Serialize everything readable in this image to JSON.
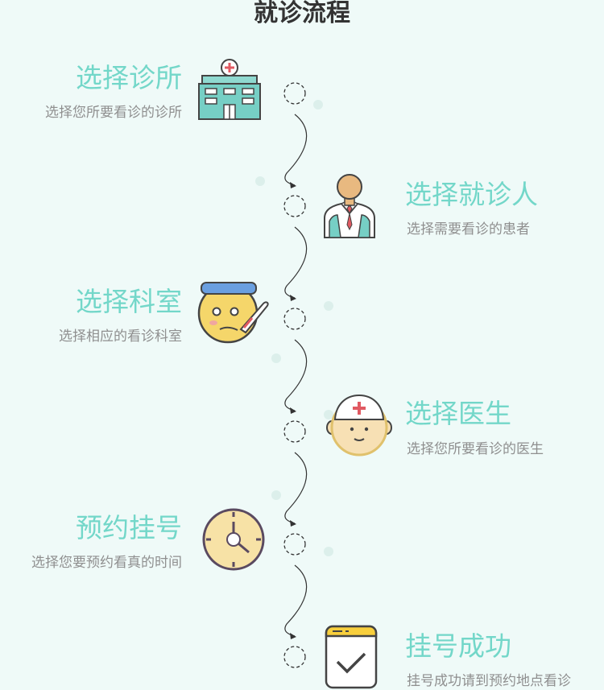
{
  "title": "就诊流程",
  "steps": [
    {
      "title": "选择诊所",
      "desc": "选择您所要看诊的诊所",
      "icon": "hospital-building-icon"
    },
    {
      "title": "选择就诊人",
      "desc": "选择需要看诊的患者",
      "icon": "doctor-person-icon"
    },
    {
      "title": "选择科室",
      "desc": "选择相应的看诊科室",
      "icon": "sick-face-thermometer-icon"
    },
    {
      "title": "选择医生",
      "desc": "选择您所要看诊的医生",
      "icon": "nurse-face-icon"
    },
    {
      "title": "预约挂号",
      "desc": "选择您要预约看真的时间",
      "icon": "clock-icon"
    },
    {
      "title": "挂号成功",
      "desc": "挂号成功请到预约地点看诊",
      "icon": "checkmark-window-icon"
    }
  ],
  "colors": {
    "background": "#effaf8",
    "accent": "#73d7c9",
    "title": "#333333",
    "desc": "#8f8f8f"
  }
}
